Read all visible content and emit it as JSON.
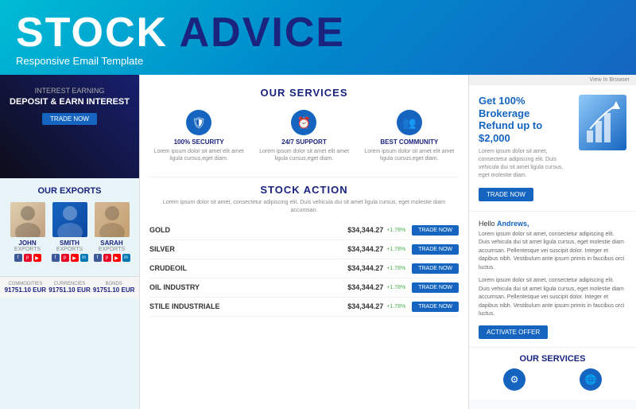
{
  "header": {
    "title_stock": "STOCK",
    "title_advice": "ADVICE",
    "subtitle": "esponsive Email Template"
  },
  "left_panel": {
    "deposit": {
      "label": "Interest Earning",
      "title": "DEPOSIT & EARN INTEREST",
      "button": "TRADE NOW"
    },
    "exports": {
      "heading": "OUR EXPORTS",
      "people": [
        {
          "name": "JOHN",
          "role": "EXPORTS"
        },
        {
          "name": "SMITH",
          "role": "EXPORTS"
        },
        {
          "name": "SARAH",
          "role": "EXPORTS"
        }
      ]
    },
    "stats": [
      {
        "label": "COMMODITIES",
        "value": "91751.10 EUR"
      },
      {
        "label": "CURRENCIES",
        "value": "91751.10 EUR"
      },
      {
        "label": "BONDS",
        "value": "91751.10 EUR"
      }
    ]
  },
  "middle_panel": {
    "services": {
      "title": "OUR SERVICES",
      "items": [
        {
          "icon": "🛡",
          "name": "100% SECURITY",
          "desc": "Lorem ipsum dolor sit amet elit amet ligula cursus,eget diam."
        },
        {
          "icon": "⏰",
          "name": "24/7 SUPPORT",
          "desc": "Lorem ipsum dolor sit amet elit amet ligula cursus,eget diam."
        },
        {
          "icon": "👥",
          "name": "BEST COMMUNITY",
          "desc": "Lorem ipsum dolor sit amet elit amet ligula cursus,eget diam."
        }
      ]
    },
    "stock_action": {
      "title": "STOCK ACTION",
      "desc": "Lorem ipsum dolor sit amet, consectetur adipiscing elit. Duis vehicula dui sit amet ligula cursus, eget molestie diam accumsan.",
      "stocks": [
        {
          "name": "GOLD",
          "price": "$34,344.27",
          "change": "+1.78%",
          "button": "TRADE NOW"
        },
        {
          "name": "SILVER",
          "price": "$34,344.27",
          "change": "+1.78%",
          "button": "TRADE NOW"
        },
        {
          "name": "CRUDEOIL",
          "price": "$34,344.27",
          "change": "+1.78%",
          "button": "TRADE NOW"
        },
        {
          "name": "OIL INDUSTRY",
          "price": "$34,344.27",
          "change": "+1.78%",
          "button": "TRADE NOW"
        },
        {
          "name": "STILE INDUSTRIALE",
          "price": "$34,344.27",
          "change": "+1.78%",
          "button": "TRADE NOW"
        }
      ]
    }
  },
  "right_panel": {
    "view_in_browser": "View In Browser",
    "promo": {
      "title_prefix": "Get ",
      "title_highlight": "100% Brokerage",
      "title_suffix": "Refund up to $2,000",
      "desc": "Lorem ipsum dolor sit amet, consectetur adipiscing elit. Duis vehicula dui sit amet ligula cursus, eget molestie diam.",
      "button": "TRADE NOW"
    },
    "hello": {
      "greeting": "Hello ",
      "name": "Andrews,",
      "para1": "Lorem ipsum dolor sit amet, consectetur adipiscing elit. Duis vehicula dui sit amet ligula cursus, eget molestie diam accumsan. Pellentesque vei suscipit dolor. Integer et dapibus nibh. Vestibulum ante ipsum primis in faucibus orci luctus.",
      "para2": "Lorem ipsum dolor sit amet, consectetur adipiscing elit. Duis vehicula dui sit amet ligula cursus, eget molestie diam accumsan. Pellentesque vei suscipit dolor. Integer et dapibus nibh. Vestibulum ante ipsum primis in faucibus orci luctus.",
      "button": "ACTIVATE OFFER"
    },
    "our_services": {
      "title": "OUR SERVICES",
      "items": [
        {
          "icon": "⚙",
          "name": ""
        },
        {
          "icon": "🌐",
          "name": ""
        }
      ]
    }
  }
}
